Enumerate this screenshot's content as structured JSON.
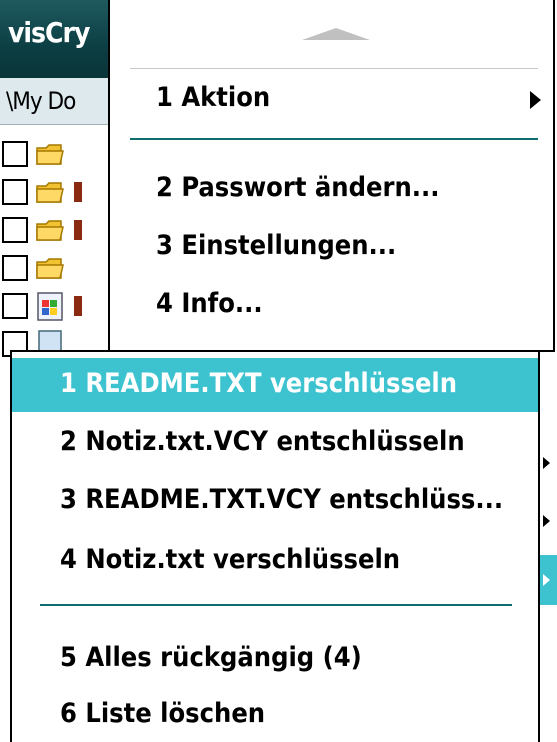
{
  "app": {
    "title": "visCry",
    "path": "\\My Do"
  },
  "file_rows": [
    {
      "icon": "folder-icon"
    },
    {
      "icon": "folder-icon"
    },
    {
      "icon": "folder-icon"
    },
    {
      "icon": "folder-icon"
    },
    {
      "icon": "document-icon"
    },
    {
      "icon": "file-icon"
    }
  ],
  "main_menu": {
    "items": [
      {
        "label": "1 Aktion",
        "has_submenu": true
      },
      {
        "label": "2 Passwort ändern..."
      },
      {
        "label": "3 Einstellungen..."
      },
      {
        "label": "4 Info..."
      }
    ]
  },
  "sub_menu": {
    "items": [
      {
        "label": "1 README.TXT verschlüsseln",
        "selected": true
      },
      {
        "label": "2 Notiz.txt.VCY entschlüsseln"
      },
      {
        "label": "3 README.TXT.VCY entschlüss..."
      },
      {
        "label": "4 Notiz.txt verschlüsseln"
      },
      {
        "label": "5 Alles rückgängig (4)"
      },
      {
        "label": "6 Liste löschen"
      }
    ]
  },
  "colors": {
    "highlight": "#3dc3d0",
    "divider": "#0f6b6e",
    "titlebar": "#0c3f44"
  }
}
